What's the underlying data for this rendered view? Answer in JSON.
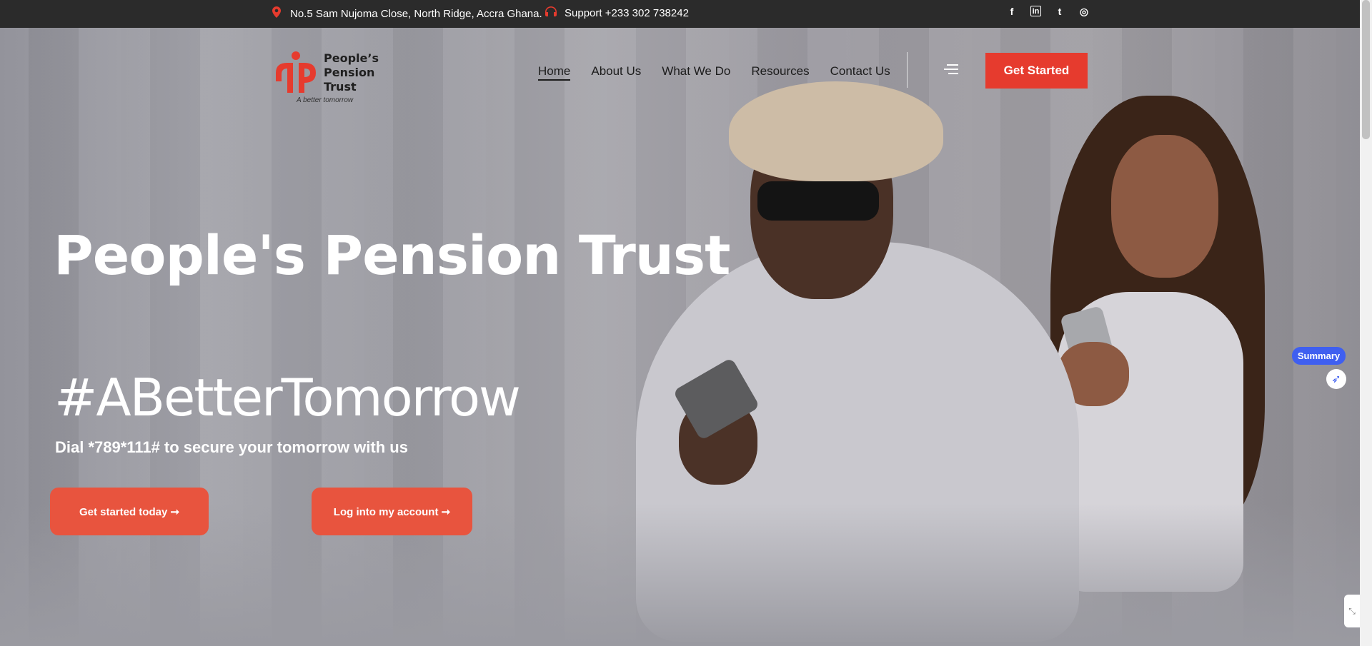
{
  "topbar": {
    "address": "No.5 Sam Nujoma Close, North Ridge, Accra Ghana.",
    "support": "Support +233 302 738242",
    "social": [
      {
        "icon": "facebook-icon",
        "glyph": "f"
      },
      {
        "icon": "linkedin-icon",
        "glyph": "in"
      },
      {
        "icon": "twitter-icon",
        "glyph": "t"
      },
      {
        "icon": "instagram-icon",
        "glyph": "◎"
      }
    ]
  },
  "logo": {
    "line1": "People’s",
    "line2": "Pension",
    "line3": "Trust",
    "tagline": "A better tomorrow"
  },
  "nav": {
    "items": [
      {
        "label": "Home",
        "active": true
      },
      {
        "label": "About Us"
      },
      {
        "label": "What We Do"
      },
      {
        "label": "Resources"
      },
      {
        "label": "Contact Us"
      }
    ],
    "cta": "Get Started"
  },
  "hero": {
    "title": "People's Pension Trust",
    "hashtag": "#ABetterTomorrow",
    "subtitle": "Dial *789*111# to secure your tomorrow with us",
    "button_primary": "Get started today ➞",
    "button_secondary": "Log into my account ➞"
  },
  "widgets": {
    "summary": "Summary"
  },
  "colors": {
    "accent": "#e63b2e",
    "topbar": "#2b2b2b",
    "summary": "#3f5ff0"
  }
}
